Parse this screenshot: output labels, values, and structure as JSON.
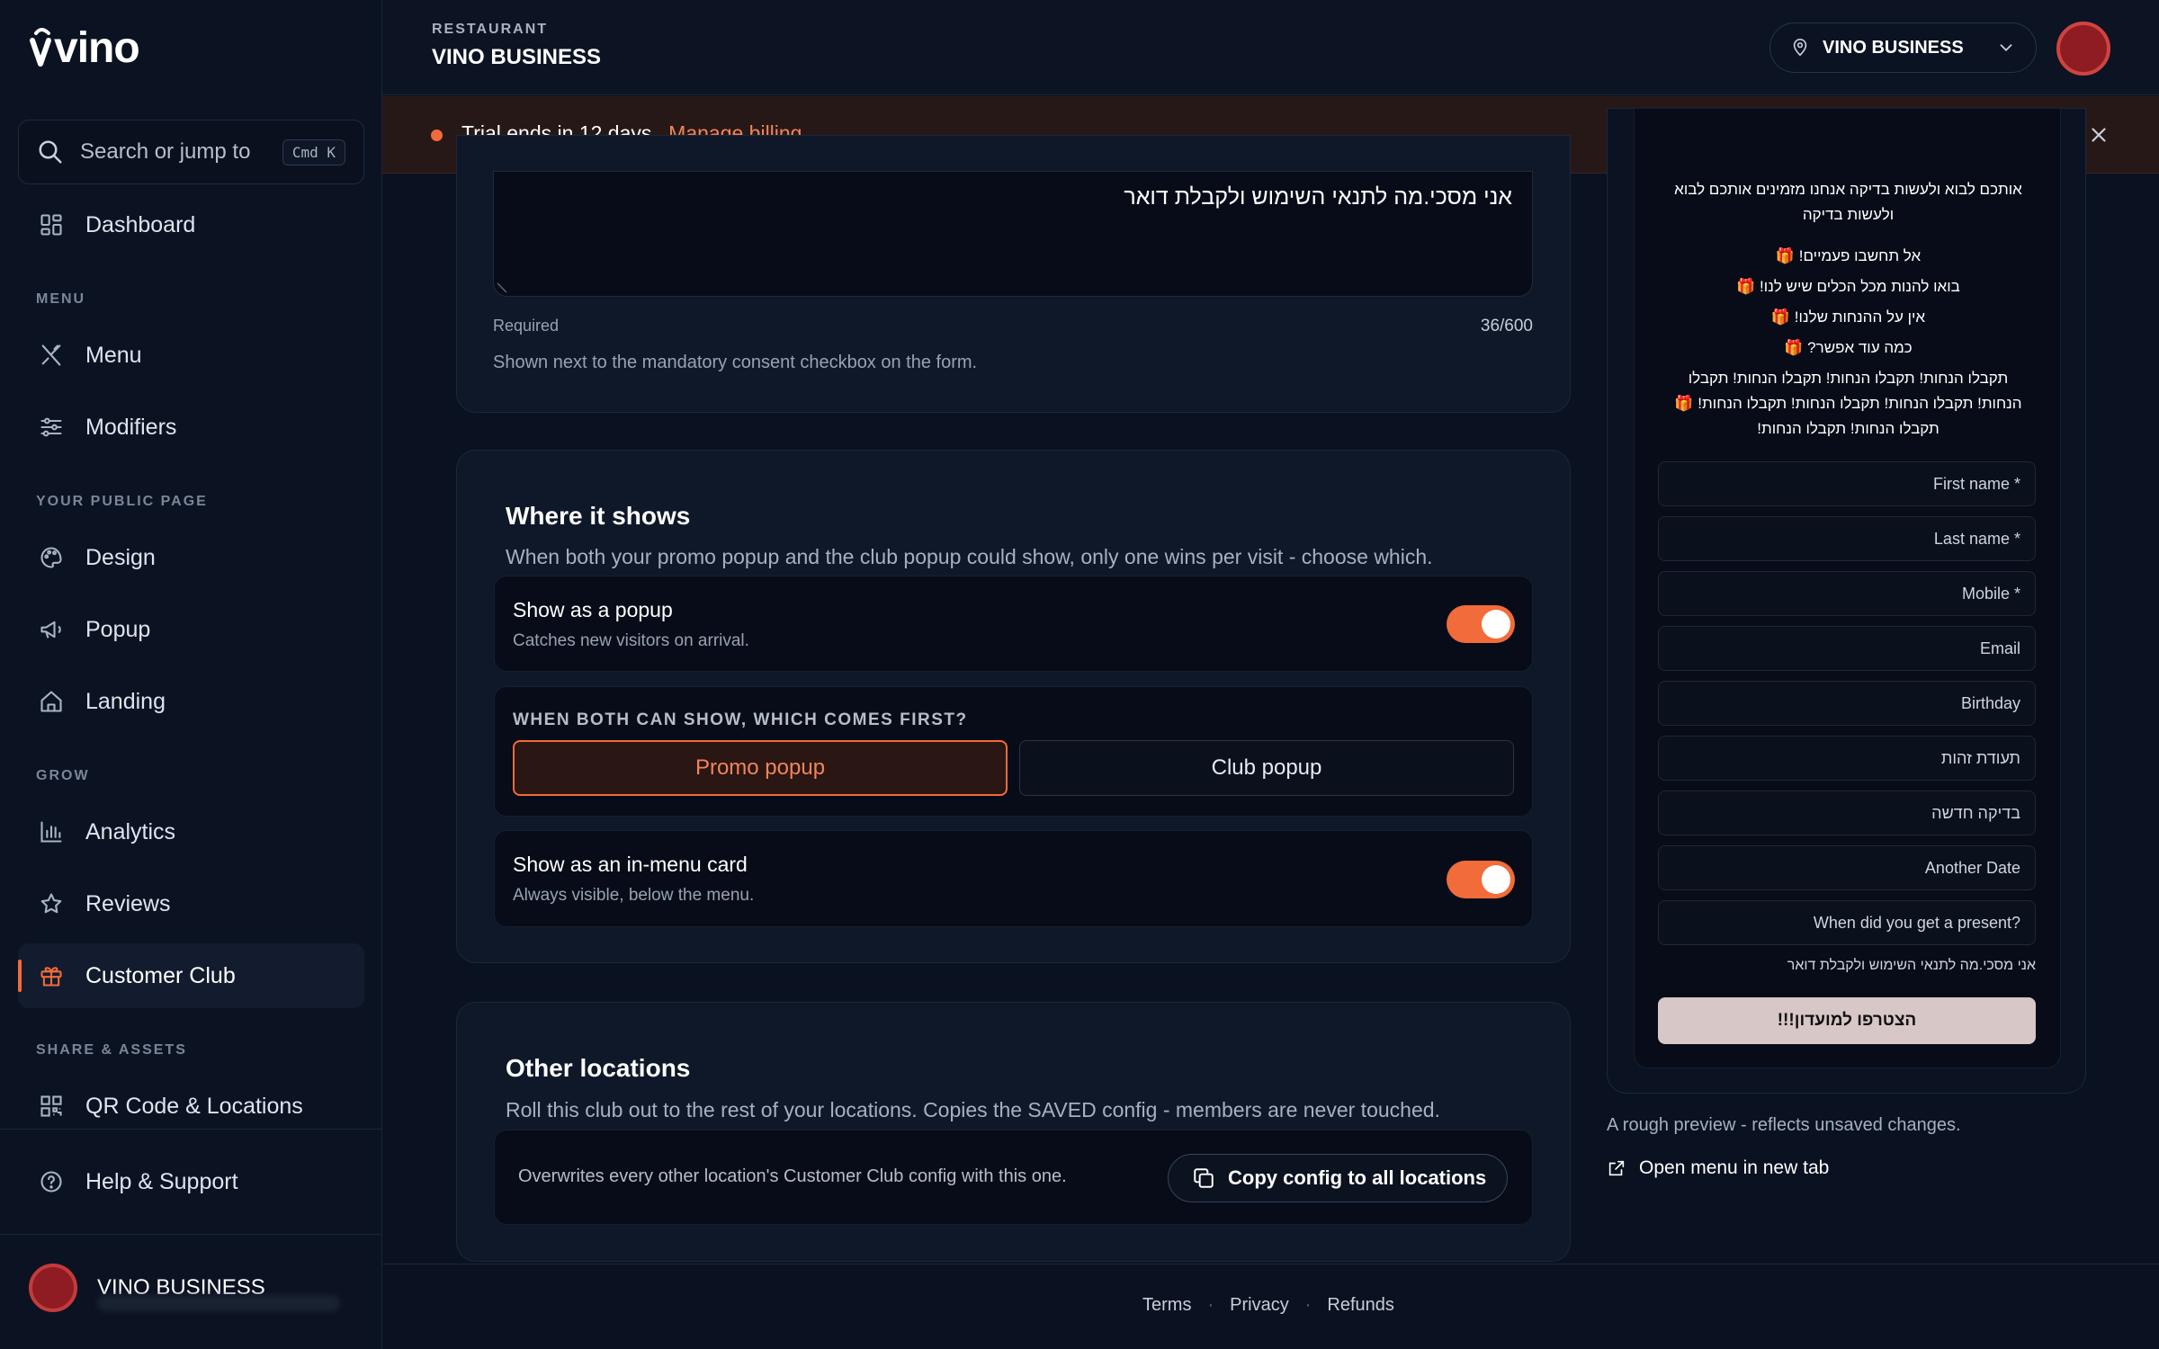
{
  "app": {
    "logo_text": "vino"
  },
  "search": {
    "placeholder": "Search or jump to",
    "shortcut": "Cmd K"
  },
  "sidebar": {
    "dashboard": "Dashboard",
    "sections": {
      "menu": "MENU",
      "public": "YOUR PUBLIC PAGE",
      "grow": "GROW",
      "share": "SHARE & ASSETS"
    },
    "items": {
      "menu": "Menu",
      "modifiers": "Modifiers",
      "design": "Design",
      "popup": "Popup",
      "landing": "Landing",
      "analytics": "Analytics",
      "reviews": "Reviews",
      "customer_club": "Customer Club",
      "qr": "QR Code & Locations",
      "help": "Help & Support"
    },
    "active": "customer_club",
    "user": {
      "name": "VINO BUSINESS"
    }
  },
  "header": {
    "restaurant_label": "RESTAURANT",
    "restaurant_name": "VINO BUSINESS",
    "location_selector": "VINO BUSINESS"
  },
  "banner": {
    "message": "Trial ends in 12 days.",
    "link": "Manage billing"
  },
  "consent": {
    "value": "אני מסכי.מה לתנאי השימוש ולקבלת דואר",
    "required": "Required",
    "counter": "36/600",
    "help": "Shown next to the mandatory consent checkbox on the form."
  },
  "where": {
    "title": "Where it shows",
    "subtitle": "When both your promo popup and the club popup could show, only one wins per visit - choose which.",
    "popup": {
      "title": "Show as a popup",
      "sub": "Catches new visitors on arrival.",
      "enabled": true
    },
    "priority": {
      "label": "WHEN BOTH CAN SHOW, WHICH COMES FIRST?",
      "options": [
        "Promo popup",
        "Club popup"
      ],
      "selected": "Promo popup"
    },
    "inmenu": {
      "title": "Show as an in-menu card",
      "sub": "Always visible, below the menu.",
      "enabled": true
    }
  },
  "other": {
    "title": "Other locations",
    "subtitle": "Roll this club out to the rest of your locations. Copies the SAVED config - members are never touched.",
    "note": "Overwrites every other location's Customer Club config with this one.",
    "button": "Copy config to all locations"
  },
  "preview": {
    "intro_line1": "אותכם לבוא ולעשות בדיקה אנחנו מזמינים אותכם לבוא",
    "intro_line2": "ולעשות בדיקה",
    "bullets": [
      "אל תחשבו פעמיים! 🎁",
      "בואו להנות מכל הכלים שיש לנו! 🎁",
      "אין על ההנחות שלנו! 🎁",
      "כמה עוד אפשר? 🎁"
    ],
    "promo_line1": "תקבלו הנחות! תקבלו הנחות! תקבלו הנחות! תקבלו",
    "promo_line2": "הנחות! תקבלו הנחות! תקבלו הנחות! תקבלו הנחות! 🎁",
    "promo_line3": "תקבלו הנחות! תקבלו הנחות!",
    "fields": [
      "* First name",
      "* Last name",
      "* Mobile",
      "Email",
      "Birthday",
      "תעודת זהות",
      "בדיקה חדשה",
      "Another Date",
      "?When did you get a present"
    ],
    "consent": "אני מסכי.מה לתנאי השימוש ולקבלת דואר",
    "join": "הצטרפו למועדון!!!",
    "note": "A rough preview - reflects unsaved changes.",
    "open_link": "Open menu in new tab"
  },
  "footer": {
    "links": [
      "Terms",
      "Privacy",
      "Refunds"
    ]
  },
  "colors": {
    "accent": "#f26b3a",
    "bg": "#0a1120",
    "card": "#0f1829",
    "banner": "#271818"
  }
}
